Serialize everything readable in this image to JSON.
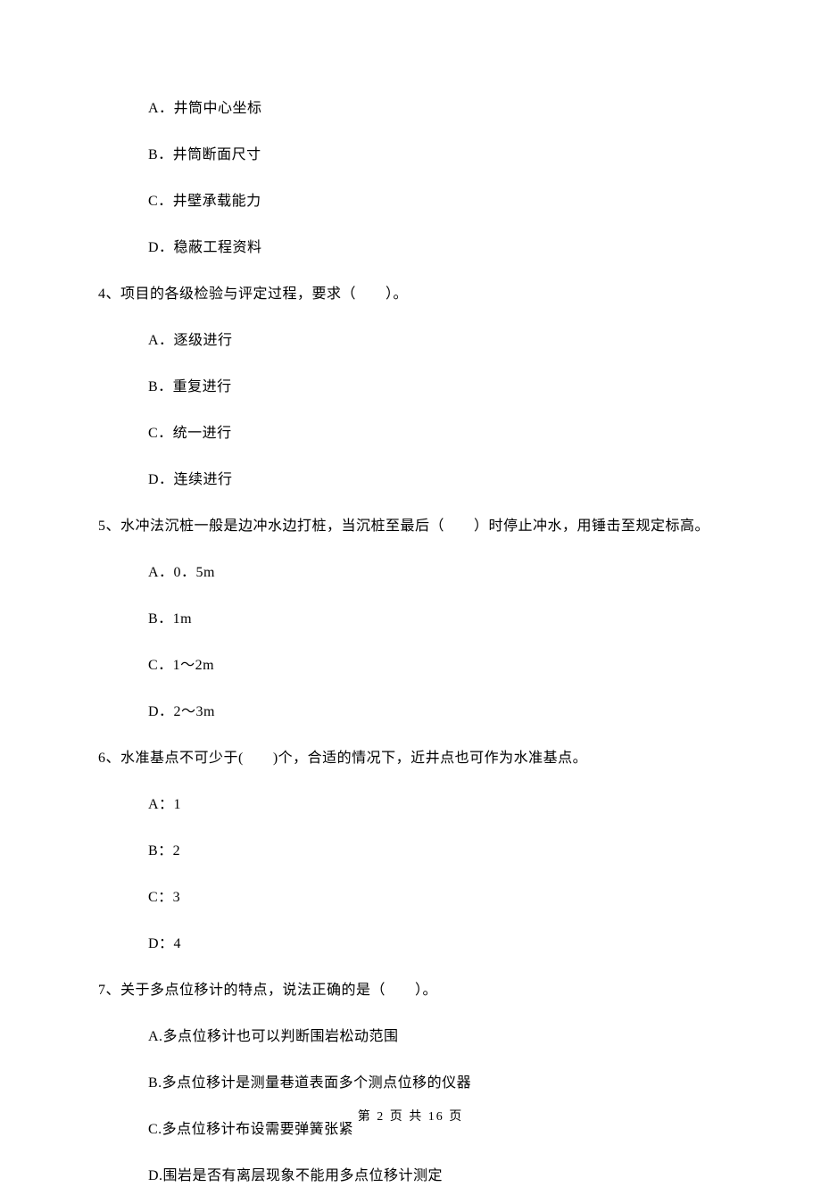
{
  "q3": {
    "options": {
      "a": "A．井筒中心坐标",
      "b": "B．井筒断面尺寸",
      "c": "C．井壁承载能力",
      "d": "D．稳蔽工程资料"
    }
  },
  "q4": {
    "text": "4、项目的各级检验与评定过程，要求（　　）。",
    "options": {
      "a": "A．逐级进行",
      "b": "B．重复进行",
      "c": "C．统一进行",
      "d": "D．连续进行"
    }
  },
  "q5": {
    "text": "5、水冲法沉桩一般是边冲水边打桩，当沉桩至最后（　　）时停止冲水，用锤击至规定标高。",
    "options": {
      "a": "A．0．5m",
      "b": "B．1m",
      "c": "C．1～2m",
      "d": "D．2～3m"
    }
  },
  "q6": {
    "text": "6、水准基点不可少于(　　)个，合适的情况下，近井点也可作为水准基点。",
    "options": {
      "a": "A：1",
      "b": "B：2",
      "c": "C：3",
      "d": "D：4"
    }
  },
  "q7": {
    "text": "7、关于多点位移计的特点，说法正确的是（　　）。",
    "options": {
      "a": "A.多点位移计也可以判断围岩松动范围",
      "b": "B.多点位移计是测量巷道表面多个测点位移的仪器",
      "c": "C.多点位移计布设需要弹簧张紧",
      "d": "D.围岩是否有离层现象不能用多点位移计测定"
    }
  },
  "footer": "第 2 页 共 16 页"
}
